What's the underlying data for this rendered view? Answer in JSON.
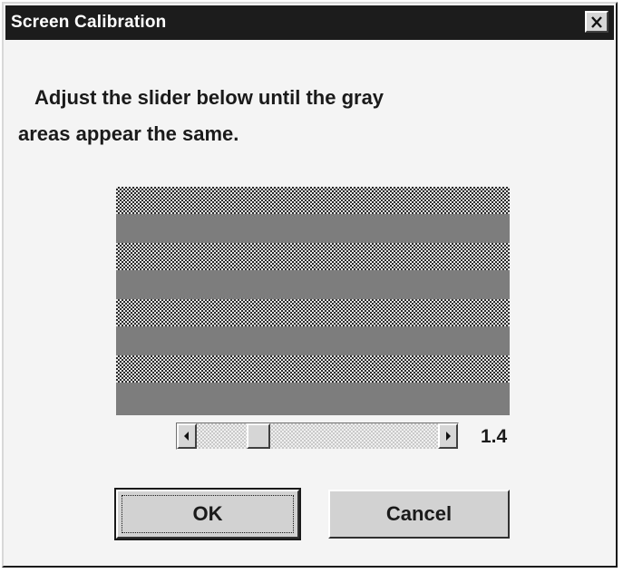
{
  "window": {
    "title": "Screen Calibration",
    "close_icon": "close-x-icon"
  },
  "instruction": {
    "line1": "Adjust the slider below until the gray",
    "line2": "areas appear the same."
  },
  "calibration": {
    "panel_color": "#7d7d7d",
    "pattern_rows": 4
  },
  "slider": {
    "value_label": "1.4",
    "level_fraction": 0.23,
    "left_arrow_icon": "triangle-left-icon",
    "right_arrow_icon": "triangle-right-icon"
  },
  "buttons": {
    "ok_label": "OK",
    "cancel_label": "Cancel"
  }
}
